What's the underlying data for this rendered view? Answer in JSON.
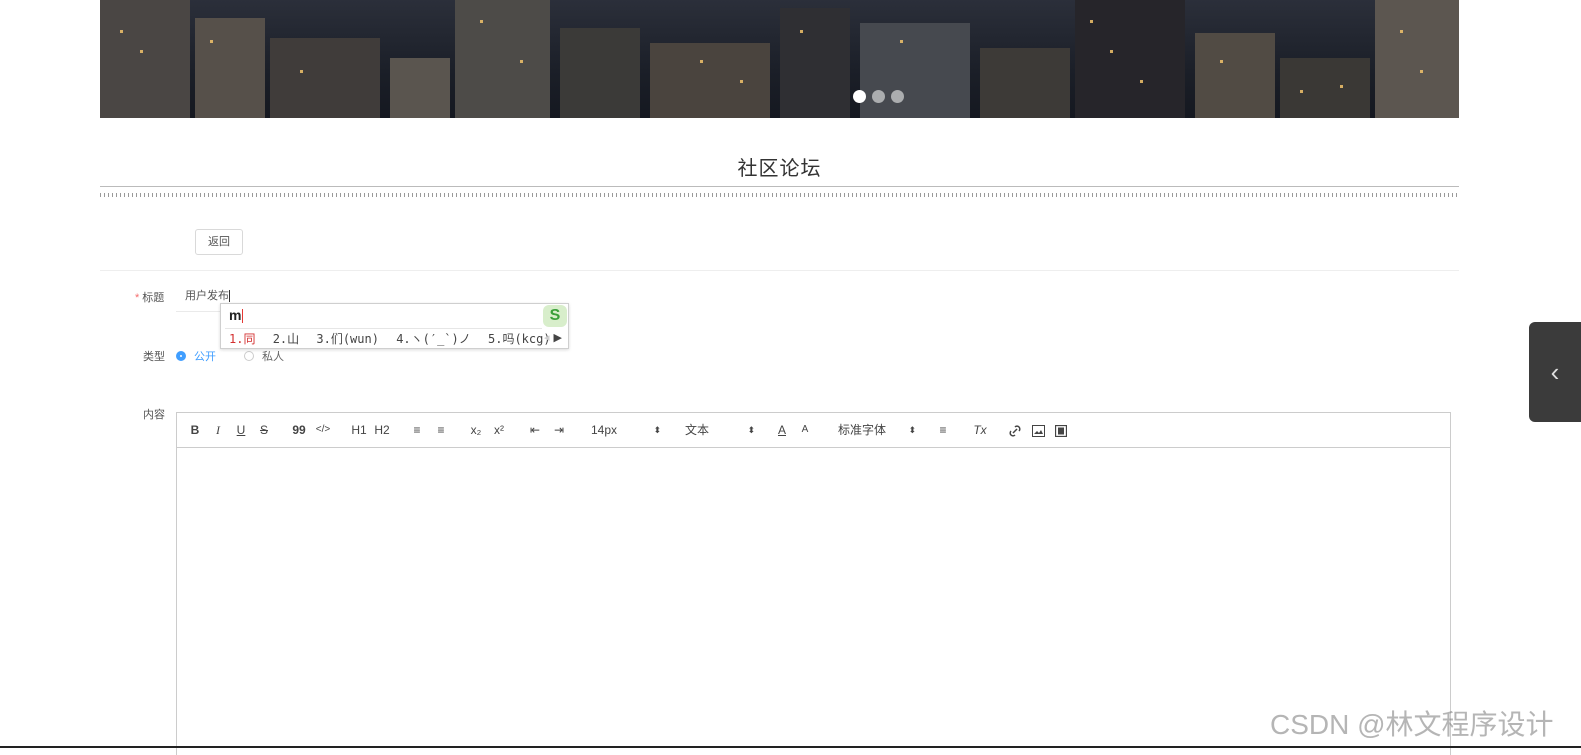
{
  "banner": {
    "slides": 3,
    "active_slide": 1
  },
  "page_title": "社区论坛",
  "back_label": "返回",
  "form": {
    "title_required_mark": "*",
    "title_label": "标题",
    "title_value": "用户发布",
    "type_label": "类型",
    "type_options": [
      "公开",
      "私人"
    ],
    "type_selected": "公开",
    "content_label": "内容"
  },
  "ime": {
    "composition": "m",
    "candidates": [
      "1.同",
      "2.山",
      "3.们(wun)",
      "4.ヽ(′_`)ノ",
      "5.吗(kcg)"
    ],
    "logo": "S"
  },
  "editor": {
    "toolbar": {
      "bold": "B",
      "italic": "I",
      "underline": "U",
      "strike": "S",
      "blockquote": "99",
      "code": "</>",
      "h1": "H1",
      "h2": "H2",
      "ordered_list": "≡",
      "bullet_list": "≡",
      "subscript": "x₂",
      "superscript": "x²",
      "outdent": "⇤",
      "indent": "⇥",
      "size": "14px",
      "header": "文本",
      "font": "标准字体",
      "color": "A",
      "background": "A",
      "align": "≡",
      "clean": "Tx"
    }
  },
  "watermark": "CSDN @林文程序设计",
  "colors": {
    "accent": "#409eff",
    "required": "#f56c6c"
  }
}
